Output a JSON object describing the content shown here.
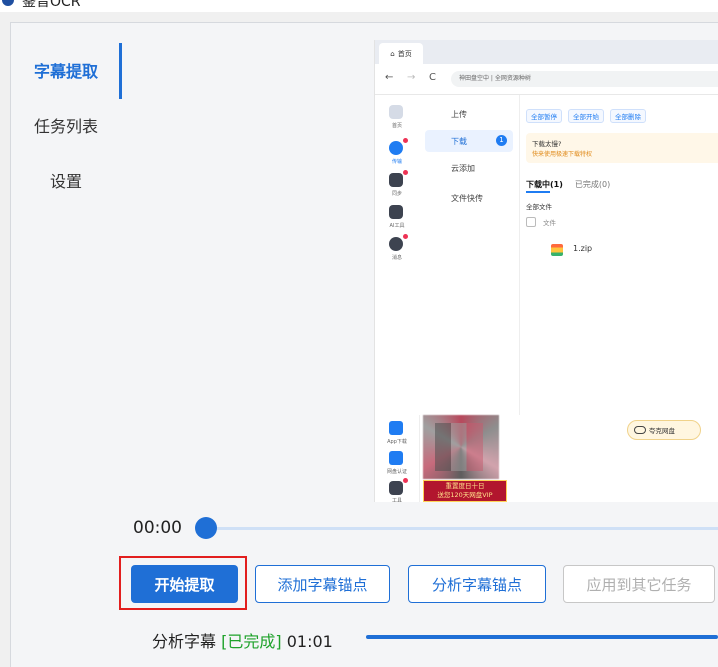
{
  "window": {
    "title": "鉴音OCR"
  },
  "sidebar": {
    "items": [
      {
        "label": "字幕提取",
        "active": true
      },
      {
        "label": "任务列表",
        "active": false
      },
      {
        "label": "设置",
        "active": false
      }
    ]
  },
  "preview": {
    "browser_tab": "首页",
    "url_text": "神田盘空中 | 全网资源种树",
    "nav_icons": [
      "back-icon",
      "forward-icon",
      "reload-icon"
    ],
    "left_labels": [
      "首页",
      "传输",
      "同步",
      "AI工具",
      "消息"
    ],
    "left_bottom_labels": [
      "App下载",
      "网盘认证",
      "工具"
    ],
    "middle_items": [
      "上传",
      "下载",
      "云添加",
      "文件快传"
    ],
    "download_badge": "1",
    "actions": [
      "全部暂停",
      "全部开始",
      "全部删除"
    ],
    "warn_title": "下载太慢?",
    "warn_sub": "快来使用极速下载特权",
    "tabs": {
      "current": "下载中(1)",
      "other": "已完成(0)"
    },
    "all_files": "全部文件",
    "col_file": "文件",
    "file_name": "1.zip",
    "ad_text_1": "重置度日十日",
    "ad_text_2": "送您120天网盘VIP",
    "quark_label": "夸克网盘"
  },
  "player": {
    "time": "00:00",
    "progress": 0.0
  },
  "buttons": {
    "start": "开始提取",
    "add_anchor": "添加字幕锚点",
    "analyze_anchor": "分析字幕锚点",
    "apply_others": "应用到其它任务"
  },
  "status": {
    "label": "分析字幕",
    "state": "[已完成]",
    "time": "01:01",
    "progress": 1.0
  },
  "colors": {
    "accent": "#1f6fd6",
    "done": "#1fa22b",
    "highlight": "#e21e1e"
  }
}
